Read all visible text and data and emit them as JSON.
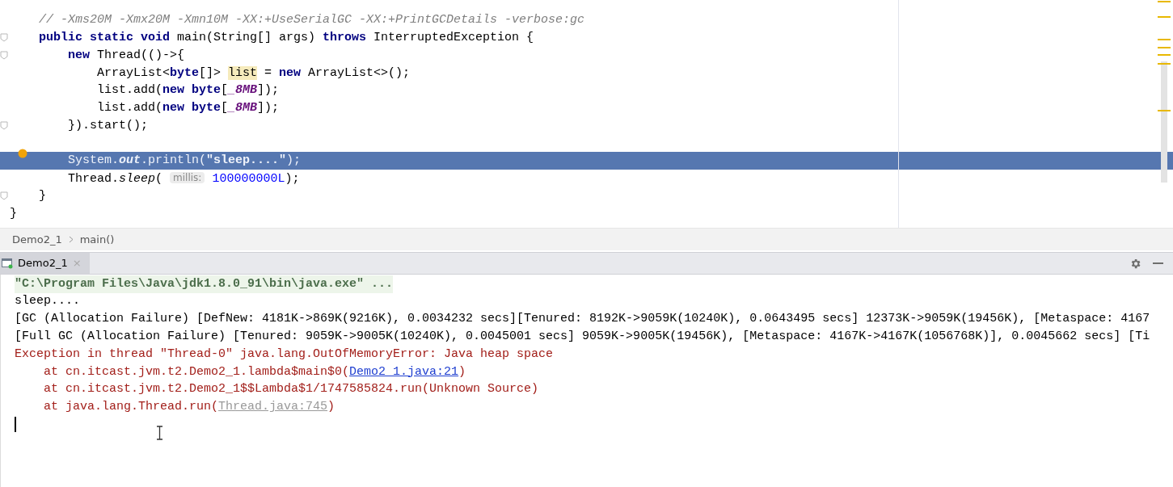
{
  "editor": {
    "lines": [
      {
        "kind": "code",
        "fold": false,
        "marker": false,
        "highlighted": false,
        "tokens": [
          {
            "kind": "comment",
            "text": "    // -Xms20M -Xmx20M -Xmn10M -XX:+UseSerialGC -XX:+PrintGCDetails -verbose:gc"
          }
        ]
      },
      {
        "kind": "code",
        "fold": true,
        "marker": false,
        "highlighted": false,
        "tokens": [
          {
            "kind": "keyword",
            "text": "    public static void"
          },
          {
            "kind": "plain",
            "text": " main(String[] args) "
          },
          {
            "kind": "keyword",
            "text": "throws"
          },
          {
            "kind": "plain",
            "text": " InterruptedException {"
          }
        ]
      },
      {
        "kind": "code",
        "fold": true,
        "marker": false,
        "highlighted": false,
        "tokens": [
          {
            "kind": "keyword",
            "text": "        new"
          },
          {
            "kind": "plain",
            "text": " Thread(()->{"
          }
        ]
      },
      {
        "kind": "code",
        "fold": false,
        "marker": false,
        "highlighted": false,
        "tokens": [
          {
            "kind": "plain",
            "text": "            ArrayList<"
          },
          {
            "kind": "keyword",
            "text": "byte"
          },
          {
            "kind": "plain",
            "text": "[]> "
          },
          {
            "kind": "usage",
            "text": "list"
          },
          {
            "kind": "plain",
            "text": " = "
          },
          {
            "kind": "keyword",
            "text": "new"
          },
          {
            "kind": "plain",
            "text": " ArrayList<>();"
          }
        ]
      },
      {
        "kind": "code",
        "fold": false,
        "marker": false,
        "highlighted": false,
        "tokens": [
          {
            "kind": "plain",
            "text": "            list.add("
          },
          {
            "kind": "keyword",
            "text": "new byte"
          },
          {
            "kind": "plain",
            "text": "["
          },
          {
            "kind": "constant",
            "text": "_8MB"
          },
          {
            "kind": "plain",
            "text": "]);"
          }
        ]
      },
      {
        "kind": "code",
        "fold": false,
        "marker": false,
        "highlighted": false,
        "tokens": [
          {
            "kind": "plain",
            "text": "            list.add("
          },
          {
            "kind": "keyword",
            "text": "new byte"
          },
          {
            "kind": "plain",
            "text": "["
          },
          {
            "kind": "constant",
            "text": "_8MB"
          },
          {
            "kind": "plain",
            "text": "]);"
          }
        ]
      },
      {
        "kind": "code",
        "fold": true,
        "marker": false,
        "highlighted": false,
        "tokens": [
          {
            "kind": "plain",
            "text": "        }).start();"
          }
        ]
      },
      {
        "kind": "blank"
      },
      {
        "kind": "code",
        "fold": false,
        "marker": true,
        "highlighted": true,
        "tokens": [
          {
            "kind": "plain",
            "text": "        System."
          },
          {
            "kind": "field",
            "text": "out"
          },
          {
            "kind": "plain",
            "text": ".println("
          },
          {
            "kind": "string",
            "text": "\"sleep....\""
          },
          {
            "kind": "plain",
            "text": ");"
          }
        ]
      },
      {
        "kind": "code",
        "fold": false,
        "marker": false,
        "highlighted": false,
        "tokens": [
          {
            "kind": "plain",
            "text": "        Thread."
          },
          {
            "kind": "method",
            "text": "sleep"
          },
          {
            "kind": "plain",
            "text": "( "
          },
          {
            "kind": "hint",
            "text": "millis:"
          },
          {
            "kind": "number",
            "text": "100000000L"
          },
          {
            "kind": "plain",
            "text": ");"
          }
        ]
      },
      {
        "kind": "code",
        "fold": true,
        "marker": false,
        "highlighted": false,
        "tokens": [
          {
            "kind": "plain",
            "text": "    }"
          }
        ]
      },
      {
        "kind": "code",
        "fold": false,
        "marker": false,
        "highlighted": false,
        "tokens": [
          {
            "kind": "plain",
            "text": "}"
          }
        ]
      }
    ]
  },
  "breadcrumb": [
    "Demo2_1",
    "main()"
  ],
  "run_panel": {
    "tabs": [
      {
        "label": "Demo2_1",
        "selected": true,
        "close": "×"
      }
    ],
    "console": [
      {
        "kind": "command",
        "segments": [
          {
            "kind": "text",
            "text": "\"C:\\Program Files\\Java\\jdk1.8.0_91\\bin\\java.exe\" ..."
          }
        ]
      },
      {
        "kind": "output",
        "segments": [
          {
            "kind": "text",
            "text": "sleep...."
          }
        ]
      },
      {
        "kind": "output",
        "segments": [
          {
            "kind": "text",
            "text": "[GC (Allocation Failure) [DefNew: 4181K->869K(9216K), 0.0034232 secs][Tenured: 8192K->9059K(10240K), 0.0643495 secs] 12373K->9059K(19456K), [Metaspace: 4167"
          }
        ]
      },
      {
        "kind": "output",
        "segments": [
          {
            "kind": "text",
            "text": "[Full GC (Allocation Failure) [Tenured: 9059K->9005K(10240K), 0.0045001 secs] 9059K->9005K(19456K), [Metaspace: 4167K->4167K(1056768K)], 0.0045662 secs] [Ti"
          }
        ]
      },
      {
        "kind": "error",
        "segments": [
          {
            "kind": "text",
            "text": "Exception in thread \"Thread-0\" java.lang.OutOfMemoryError: Java heap space"
          }
        ]
      },
      {
        "kind": "error",
        "segments": [
          {
            "kind": "text",
            "text": "    at cn.itcast.jvm.t2.Demo2_1.lambda$main$0("
          },
          {
            "kind": "link",
            "text": "Demo2_1.java:21"
          },
          {
            "kind": "text",
            "text": ")"
          }
        ]
      },
      {
        "kind": "error",
        "segments": [
          {
            "kind": "text",
            "text": "    at cn.itcast.jvm.t2.Demo2_1$$Lambda$1/1747585824.run(Unknown Source)"
          }
        ]
      },
      {
        "kind": "error",
        "segments": [
          {
            "kind": "text",
            "text": "    at java.lang.Thread.run("
          },
          {
            "kind": "library_link",
            "text": "Thread.java:745"
          },
          {
            "kind": "text",
            "text": ")"
          }
        ]
      }
    ]
  }
}
